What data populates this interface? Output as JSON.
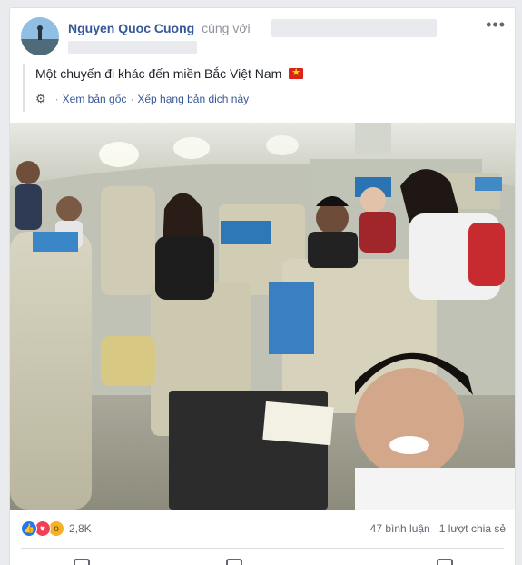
{
  "post": {
    "author_name": "Nguyen Quoc Cuong",
    "with_text": "cùng với",
    "more_icon": "ellipsis-icon",
    "text": "Một chuyến đi khác đến miền Bắc Việt Nam",
    "flag_icon": "vietnam-flag-icon",
    "see_original": "Xem bản gốc",
    "rate_translation": "Xếp hạng bản dịch này",
    "separator": "·"
  },
  "stats": {
    "reaction_icons": [
      "like-icon",
      "love-icon",
      "wow-icon"
    ],
    "reaction_count": "2,8K",
    "comments": "47 bình luận",
    "shares": "1 lượt chia sẻ"
  },
  "colors": {
    "link": "#365899",
    "like": "#2078f4",
    "love": "#f33e58",
    "wow": "#f7b125"
  }
}
